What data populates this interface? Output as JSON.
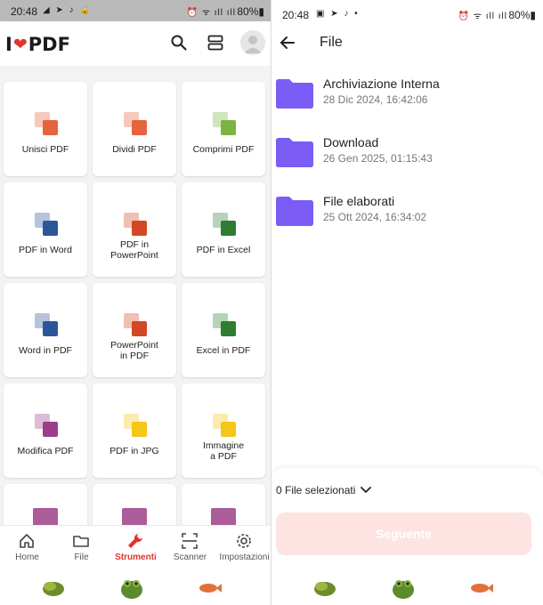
{
  "left": {
    "status": {
      "time": "20:48",
      "battery": "80%"
    },
    "logo": {
      "prefix": "I",
      "suffix": "PDF"
    },
    "tools": [
      {
        "label": "Unisci PDF",
        "icon": "merge-icon",
        "color": "#e5643d"
      },
      {
        "label": "Dividi PDF",
        "icon": "split-icon",
        "color": "#e5643d"
      },
      {
        "label": "Comprimi PDF",
        "icon": "compress-icon",
        "color": "#7cb342"
      },
      {
        "label": "PDF in Word",
        "icon": "pdf-to-word-icon",
        "color": "#2b579a"
      },
      {
        "label": "PDF in\nPowerPoint",
        "icon": "pdf-to-powerpoint-icon",
        "color": "#d24726"
      },
      {
        "label": "PDF in Excel",
        "icon": "pdf-to-excel-icon",
        "color": "#2e7d32"
      },
      {
        "label": "Word in PDF",
        "icon": "word-to-pdf-icon",
        "color": "#2b579a"
      },
      {
        "label": "PowerPoint\nin PDF",
        "icon": "powerpoint-to-pdf-icon",
        "color": "#d24726"
      },
      {
        "label": "Excel in PDF",
        "icon": "excel-to-pdf-icon",
        "color": "#2e7d32"
      },
      {
        "label": "Modifica PDF",
        "icon": "edit-pdf-icon",
        "color": "#9c3f8a"
      },
      {
        "label": "PDF in JPG",
        "icon": "pdf-to-jpg-icon",
        "color": "#f5c518"
      },
      {
        "label": "Immagine\na PDF",
        "icon": "image-to-pdf-icon",
        "color": "#f5c518"
      }
    ],
    "nav": [
      {
        "label": "Home",
        "icon": "home-icon",
        "active": false
      },
      {
        "label": "File",
        "icon": "folder-icon",
        "active": false
      },
      {
        "label": "Strumenti",
        "icon": "wrench-icon",
        "active": true
      },
      {
        "label": "Scanner",
        "icon": "scanner-icon",
        "active": false
      },
      {
        "label": "Impostazioni",
        "icon": "gear-icon",
        "active": false
      }
    ]
  },
  "right": {
    "status": {
      "time": "20:48",
      "battery": "80%"
    },
    "title": "File",
    "folders": [
      {
        "name": "Archiviazione Interna",
        "date": "28 Dic 2024, 16:42:06"
      },
      {
        "name": "Download",
        "date": "26 Gen 2025, 01:15:43"
      },
      {
        "name": "File elaborati",
        "date": "25 Ott 2024, 16:34:02"
      }
    ],
    "selected": "0 File selezionati",
    "next_label": "Seguente"
  },
  "colors": {
    "brand_red": "#e5322d",
    "folder_purple": "#7b5cf5",
    "next_disabled": "#fde3e2"
  }
}
